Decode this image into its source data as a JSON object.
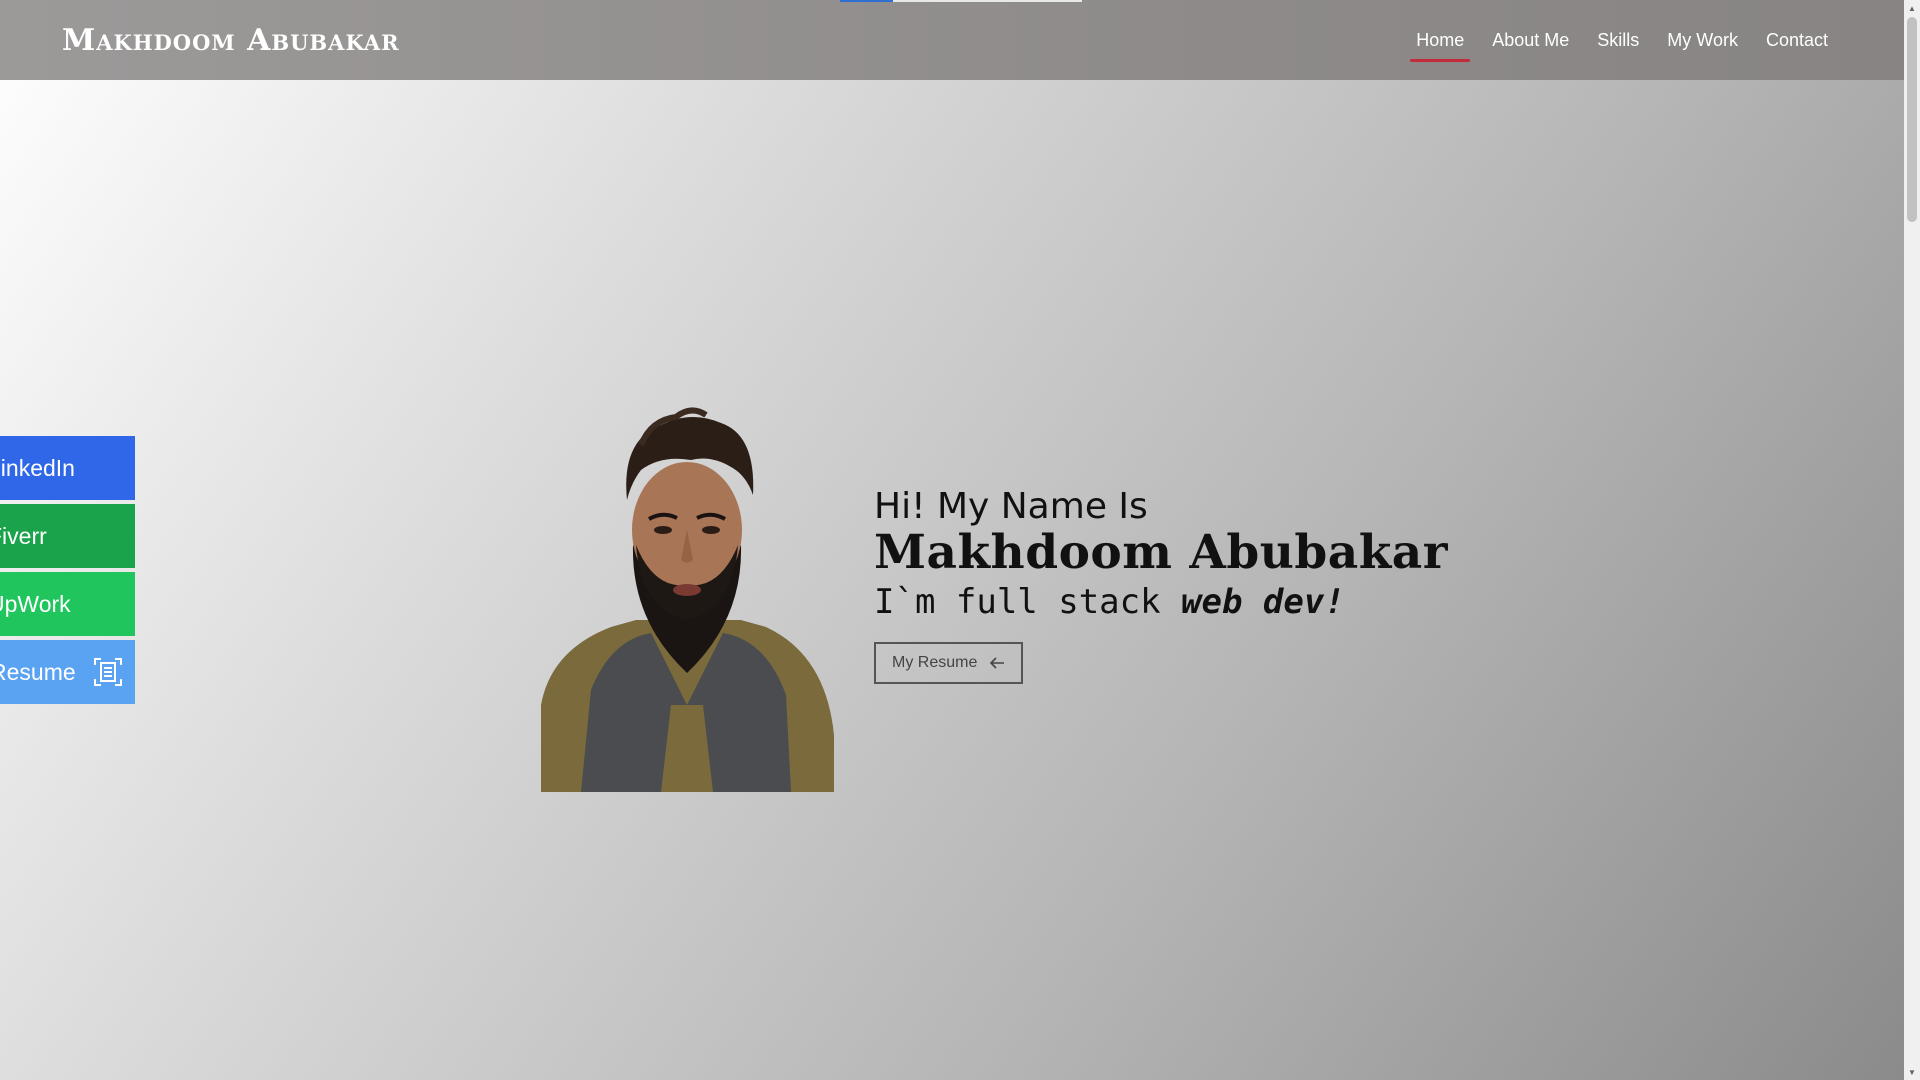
{
  "header": {
    "brand": "Makhdoom Abubakar",
    "nav": [
      {
        "label": "Home",
        "active": true
      },
      {
        "label": "About Me",
        "active": false
      },
      {
        "label": "Skills",
        "active": false
      },
      {
        "label": "My Work",
        "active": false
      },
      {
        "label": "Contact",
        "active": false
      }
    ],
    "active_underline_color": "#c42b3a"
  },
  "loading_bar": {
    "progress": 0.22,
    "color": "#2f6fd1"
  },
  "social": {
    "items": [
      {
        "label": "LinkedIn",
        "color": "#2f67e8"
      },
      {
        "label": "Fiverr",
        "color": "#1aa34a"
      },
      {
        "label": "UpWork",
        "color": "#20c65d"
      },
      {
        "label": "Resume",
        "color": "#5aa2f2",
        "icon": "document-scan-icon"
      }
    ]
  },
  "hero": {
    "greeting": "Hi! My Name Is",
    "name": "Makhdoom Abubakar",
    "tagline_prefix": "I`m full stack ",
    "tagline_emphasis": "web dev!",
    "resume_button": {
      "label": "My Resume",
      "icon": "arrow-left-icon"
    },
    "photo_alt": "profile-photo"
  }
}
